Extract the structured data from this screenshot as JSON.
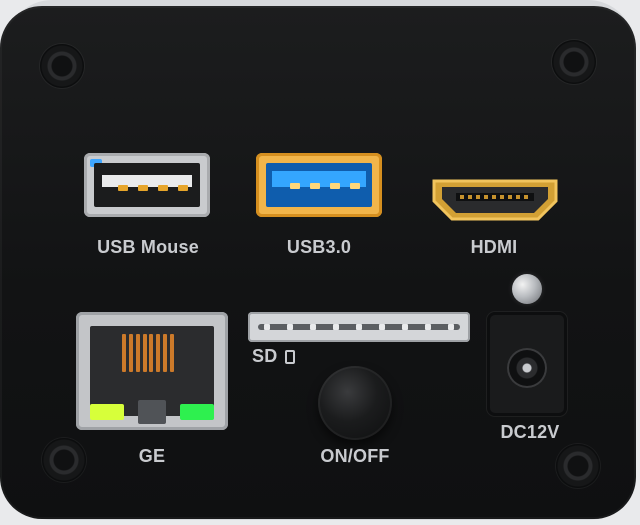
{
  "labels": {
    "usb_mouse": "USB Mouse",
    "usb3": "USB3.0",
    "hdmi": "HDMI",
    "sd": "SD",
    "ge": "GE",
    "onoff": "ON/OFF",
    "dc": "DC12V"
  }
}
